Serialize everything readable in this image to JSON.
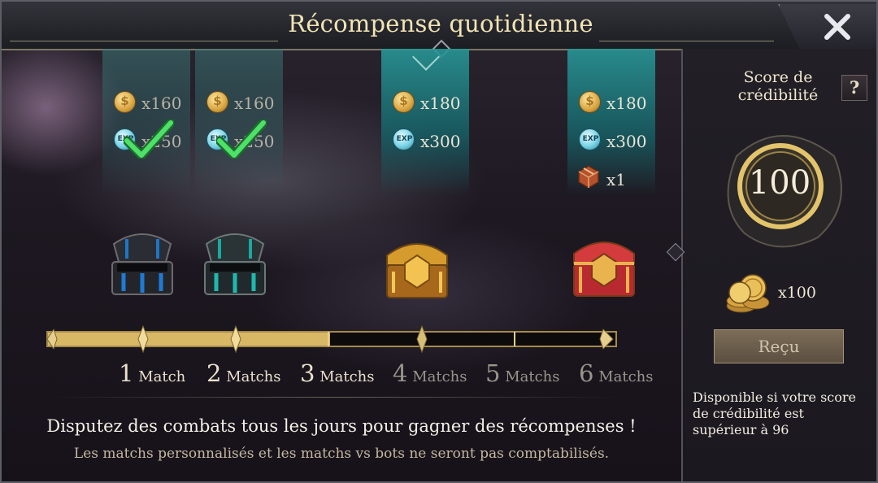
{
  "title": "Récompense quotidienne",
  "rewards": [
    {
      "match": 1,
      "gold": "x160",
      "exp": "x250",
      "claimed": true
    },
    {
      "match": 2,
      "gold": "x160",
      "exp": "x250",
      "claimed": true
    },
    {
      "match": 4,
      "gold": "x180",
      "exp": "x300",
      "claimed": false
    },
    {
      "match": 6,
      "gold": "x180",
      "exp": "x300",
      "item": "x1",
      "claimed": false
    }
  ],
  "progress": {
    "completed_matches": 3,
    "total_matches": 6,
    "labels": [
      {
        "num": "1",
        "word": "Match"
      },
      {
        "num": "2",
        "word": "Matchs"
      },
      {
        "num": "3",
        "word": "Matchs"
      },
      {
        "num": "4",
        "word": "Matchs"
      },
      {
        "num": "5",
        "word": "Matchs"
      },
      {
        "num": "6",
        "word": "Matchs"
      }
    ]
  },
  "credit_panel": {
    "title": "Score de crédibilité",
    "help": "?",
    "score": "100",
    "reward": "x100",
    "button": "Reçu",
    "condition": "Disponible si votre score de crédibilité est supérieur à 96"
  },
  "footer": {
    "hint": "Disputez des combats tous les jours pour gagner des récompenses !",
    "sub_hint": "Les matchs personnalisés et les matchs vs bots ne seront pas comptabilisés."
  },
  "colors": {
    "gold_bar": "#d9b865",
    "title_text": "#f2e4b5",
    "banner_teal": "#22868a",
    "check_green": "#3fd05a"
  }
}
